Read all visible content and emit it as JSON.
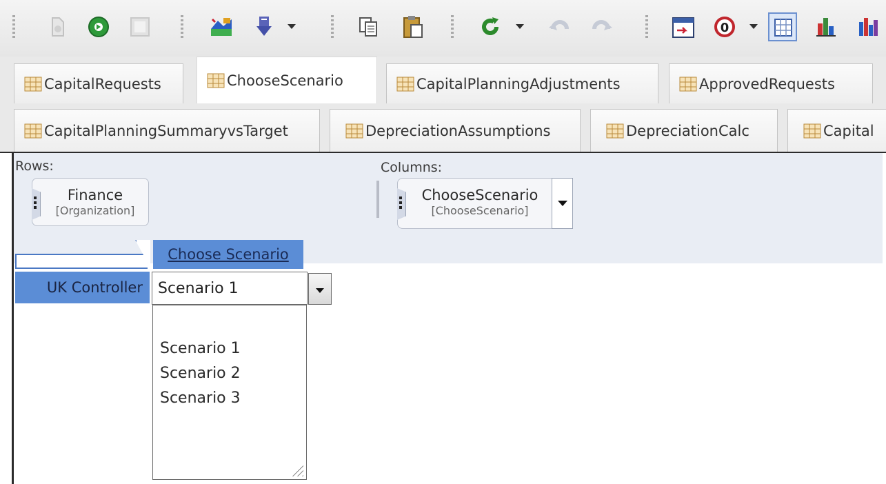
{
  "toolbar": {
    "groups": [
      {
        "icons": [
          "new-item-icon",
          "go-icon",
          "blank-icon"
        ]
      },
      {
        "icons": [
          "chart-wizard-icon",
          "import-icon"
        ]
      },
      {
        "icons": [
          "copy-icon",
          "paste-icon"
        ]
      },
      {
        "icons": [
          "refresh-icon",
          "undo-icon",
          "redo-icon"
        ]
      },
      {
        "icons": [
          "calendar-icon",
          "currency-icon",
          "grid-view-icon",
          "bar-chart-icon",
          "column-chart-icon"
        ]
      }
    ],
    "colors": {
      "go": "#2e9a3a",
      "refresh": "#2c8a2c",
      "currency": "#c0262d",
      "chart": "#2860c4"
    }
  },
  "tabs_row1": [
    {
      "label": "CapitalRequests",
      "active": false
    },
    {
      "label": "ChooseScenario",
      "active": true
    },
    {
      "label": "CapitalPlanningAdjustments",
      "active": false
    },
    {
      "label": "ApprovedRequests",
      "active": false
    }
  ],
  "tabs_row2": [
    {
      "label": "CapitalPlanningSummaryvsTarget"
    },
    {
      "label": "DepreciationAssumptions"
    },
    {
      "label": "DepreciationCalc"
    },
    {
      "label": "Capital"
    }
  ],
  "pivot": {
    "rows_label": "Rows:",
    "columns_label": "Columns:",
    "row_field": {
      "name": "Finance",
      "dimension": "[Organization]"
    },
    "column_field": {
      "name": "ChooseScenario",
      "dimension": "[ChooseScenario]"
    }
  },
  "grid": {
    "column_header": "Choose Scenario",
    "row_header": "UK Controller",
    "cell_value": "Scenario 1",
    "options": [
      "Scenario 1",
      "Scenario 2",
      "Scenario 3"
    ]
  },
  "colors": {
    "header_blue": "#5b8dd6",
    "pivot_bg": "#e9edf4",
    "tab_bg": "#e9e9e9"
  }
}
